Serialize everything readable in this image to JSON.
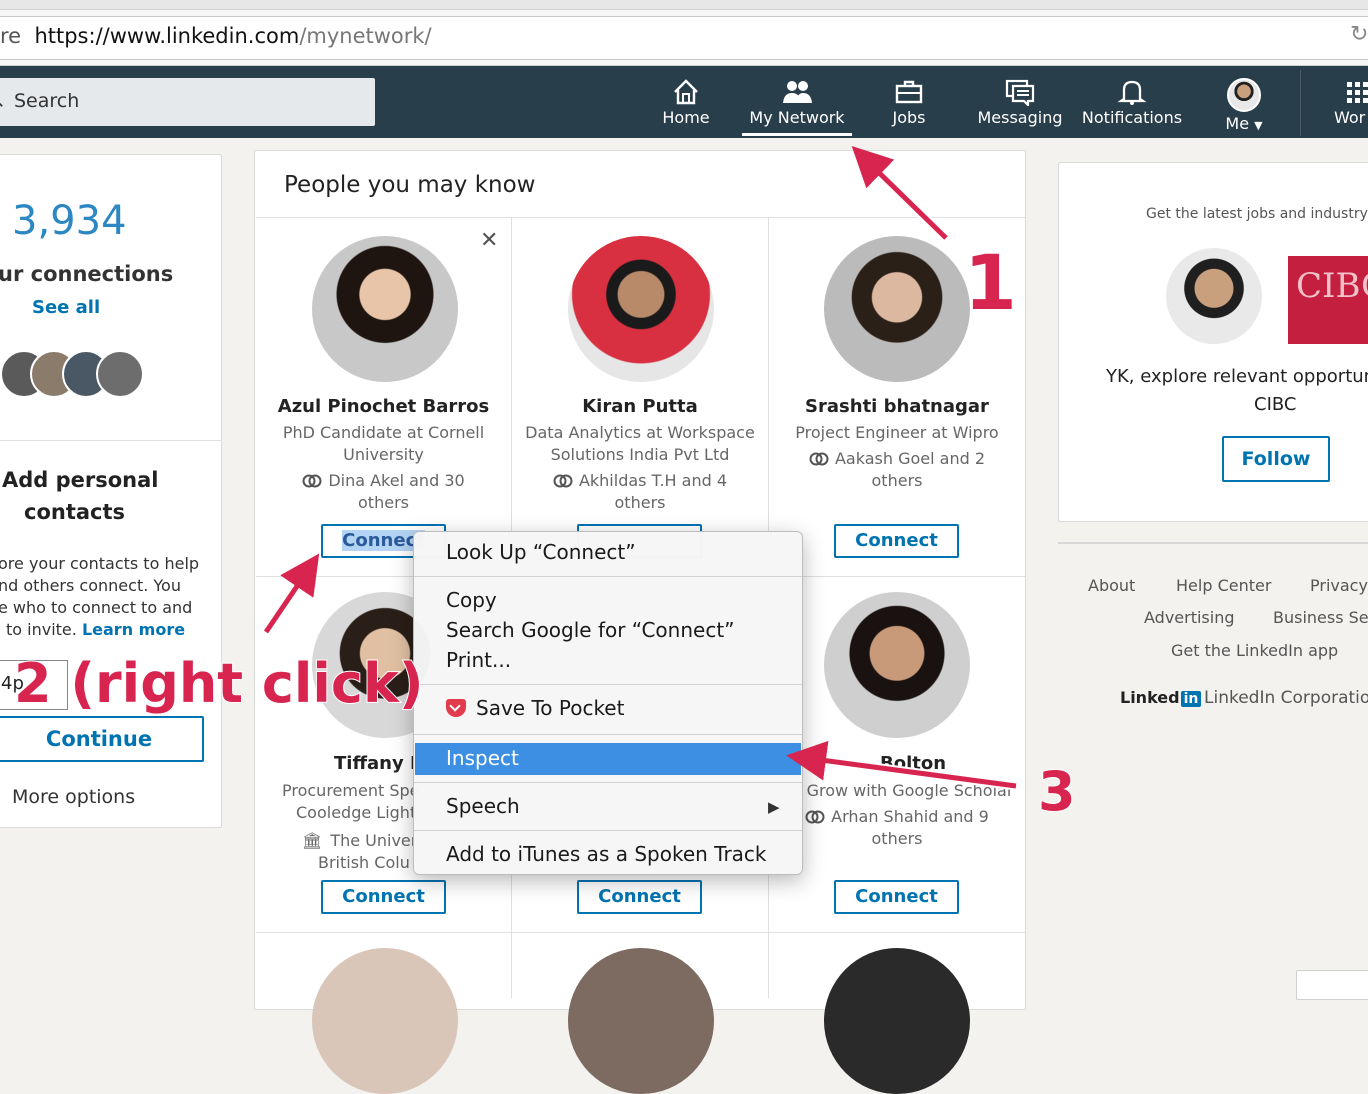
{
  "browser": {
    "url_prefix": "re",
    "url_main": "https://www.linkedin.com",
    "url_path": "/mynetwork/",
    "reload_icon": "reload-icon"
  },
  "nav": {
    "search_placeholder": "Search",
    "items": [
      {
        "label": "Home",
        "icon": "home-icon"
      },
      {
        "label": "My Network",
        "icon": "network-icon"
      },
      {
        "label": "Jobs",
        "icon": "briefcase-icon"
      },
      {
        "label": "Messaging",
        "icon": "messaging-icon"
      },
      {
        "label": "Notifications",
        "icon": "bell-icon"
      },
      {
        "label": "Me",
        "icon": "avatar"
      },
      {
        "label": "Wor",
        "icon": "grid-icon"
      }
    ]
  },
  "left": {
    "count": "3,934",
    "connections_label": "ur connections",
    "see_all": "See all",
    "add_title_1": "Add personal",
    "add_title_2": "contacts",
    "add_desc": [
      "ore your contacts to help",
      "nd others connect. You",
      "e who to connect to and",
      "to invite."
    ],
    "learn_more": "Learn more",
    "email_value": "4p",
    "continue": "Continue",
    "more_options": "More options"
  },
  "pymk": {
    "title": "People you may know",
    "dismiss_icon": "close-icon",
    "people": [
      {
        "name": "Azul Pinochet Barros",
        "headline": [
          "PhD Candidate at Cornell",
          "University"
        ],
        "mutual": [
          "Dina Akel and 30",
          "others"
        ],
        "connect": "Connect"
      },
      {
        "name": "Kiran Putta",
        "headline": [
          "Data Analytics at Workspace",
          "Solutions India Pvt Ltd"
        ],
        "mutual": [
          "Akhildas T.H and 4",
          "others"
        ],
        "connect": "Connect"
      },
      {
        "name": "Srashti bhatnagar",
        "headline": [
          "Project Engineer at Wipro"
        ],
        "mutual": [
          "Aakash Goel and 2",
          "others"
        ],
        "connect": "Connect"
      },
      {
        "name": "Tiffany L",
        "headline": [
          "Procurement Spe",
          "Cooledge Light"
        ],
        "mutual": [
          "The Univer",
          "British Colu"
        ],
        "connect": "Connect"
      },
      {
        "name": "",
        "headline": [],
        "mutual": [],
        "connect": "Connect"
      },
      {
        "name": "Bolton",
        "headline": [
          "Grow with Google Scholar"
        ],
        "mutual": [
          "Arhan Shahid and 9",
          "others"
        ],
        "connect": "Connect"
      }
    ]
  },
  "right": {
    "ad_text": "Get the latest jobs and industry",
    "ad_logo": "CIBC",
    "ad_line1": "YK, explore relevant opportuni",
    "ad_line2": "CIBC",
    "follow": "Follow",
    "footer": [
      "About",
      "Help Center",
      "Privacy",
      "Advertising",
      "Business Se",
      "Get the LinkedIn app"
    ],
    "brand_text": "Linked",
    "brand_in": "in",
    "corp": "LinkedIn Corporation"
  },
  "context_menu": {
    "items": [
      "Look Up “Connect”",
      "Copy",
      "Search Google for “Connect”",
      "Print...",
      "Save To Pocket",
      "Inspect",
      "Speech",
      "Add to iTunes as a Spoken Track"
    ],
    "submenu_arrow": "▶"
  },
  "annotations": {
    "step1": "1",
    "step2": "2 (right click)",
    "step3": "3"
  },
  "colors": {
    "nav_bg": "#283e4a",
    "link_blue": "#0073b1",
    "annotation": "#d7254f",
    "menu_highlight": "#3c8fe2"
  }
}
